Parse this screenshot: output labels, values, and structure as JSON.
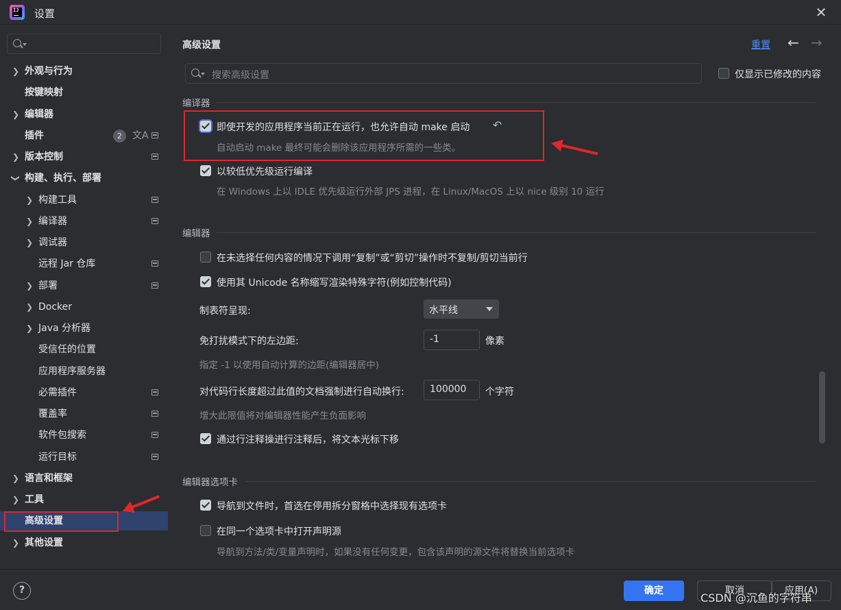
{
  "window": {
    "title": "设置"
  },
  "sidebar": {
    "items": [
      {
        "label": "外观与行为"
      },
      {
        "label": "按键映射"
      },
      {
        "label": "编辑器"
      },
      {
        "label": "插件",
        "badge": "2"
      },
      {
        "label": "版本控制"
      },
      {
        "label": "构建、执行、部署"
      },
      {
        "label": "构建工具"
      },
      {
        "label": "编译器"
      },
      {
        "label": "调试器"
      },
      {
        "label": "远程 Jar 仓库"
      },
      {
        "label": "部署"
      },
      {
        "label": "Docker"
      },
      {
        "label": "Java 分析器"
      },
      {
        "label": "受信任的位置"
      },
      {
        "label": "应用程序服务器"
      },
      {
        "label": "必需插件"
      },
      {
        "label": "覆盖率"
      },
      {
        "label": "软件包搜索"
      },
      {
        "label": "运行目标"
      },
      {
        "label": "语言和框架"
      },
      {
        "label": "工具"
      },
      {
        "label": "高级设置"
      },
      {
        "label": "其他设置"
      }
    ]
  },
  "main": {
    "title": "高级设置",
    "reset_label": "重置",
    "search_placeholder": "搜索高级设置",
    "only_modified_label": "仅显示已修改的内容",
    "sections": {
      "compiler": {
        "title": "编译器",
        "auto_make": {
          "label": "即使开发的应用程序当前正在运行，也允许自动 make 启动",
          "hint": "自动启动 make 最终可能会删除该应用程序所需的一些类。",
          "checked": true
        },
        "low_priority": {
          "label": "以较低优先级运行编译",
          "hint": "在 Windows 上以 IDLE 优先级运行外部 JPS 进程，在 Linux/MacOS 上以 nice 级别 10 运行",
          "checked": true
        }
      },
      "editor": {
        "title": "编辑器",
        "no_copy_line": {
          "label": "在未选择任何内容的情况下调用“复制”或“剪切”操作时不复制/剪切当前行",
          "checked": false
        },
        "unicode_abbrev": {
          "label": "使用其 Unicode 名称缩写渲染特殊字符(例如控制代码)",
          "checked": true
        },
        "tab_render": {
          "label": "制表符呈现:",
          "value": "水平线"
        },
        "zen_margin": {
          "label": "免打扰模式下的左边距:",
          "value": "-1",
          "unit": "像素",
          "hint": "指定 -1 以使用自动计算的边距(编辑器居中)"
        },
        "soft_wrap": {
          "label": "对代码行长度超过此值的文档强制进行自动换行:",
          "value": "100000",
          "unit": "个字符",
          "hint": "增大此限值将对编辑器性能产生负面影响"
        },
        "move_caret": {
          "label": "通过行注释操进行注释后，将文本光标下移",
          "checked": true
        }
      },
      "editor_tabs": {
        "title": "编辑器选项卡",
        "prefer_existing": {
          "label": "导航到文件时，首选在停用拆分窗格中选择现有选项卡",
          "checked": true
        },
        "open_declaration": {
          "label": "在同一个选项卡中打开声明源",
          "hint": "导航到方法/类/变量声明时，如果没有任何变更，包含该声明的源文件将替换当前选项卡",
          "checked": false
        }
      }
    }
  },
  "footer": {
    "help_label": "?",
    "ok_label": "确定",
    "cancel_label": "取消",
    "apply_label": "应用(A)",
    "watermark": "CSDN @沉鱼的字符串"
  },
  "colors": {
    "accent": "#3574f0",
    "selection": "#2e436e",
    "annotation": "#e0272b",
    "link": "#548af7"
  },
  "icons": {
    "search": "search-icon",
    "undo": "undo-icon",
    "manage": "manage-icon",
    "translate": "translate-icon"
  }
}
